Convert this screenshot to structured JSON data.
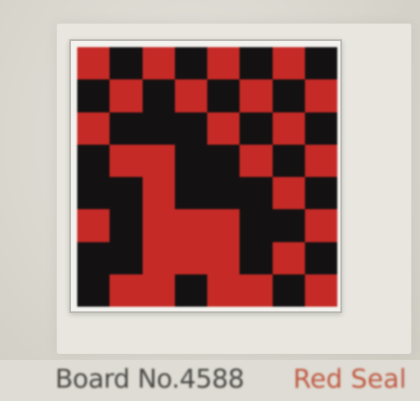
{
  "label": {
    "board": "Board No.4588",
    "seal": "Red Seal"
  },
  "colors": {
    "red": "#c52a26",
    "black": "#141112",
    "seal_text": "#c05a43"
  },
  "board": {
    "rows": [
      "RBRBRBRB",
      "BRBRBRBR",
      "RBBBRBRB",
      "BRRBBRBR",
      "BBRBBBRB",
      "RBRRRBBR",
      "BBRRRBRB",
      "BRRBRRBR"
    ]
  }
}
